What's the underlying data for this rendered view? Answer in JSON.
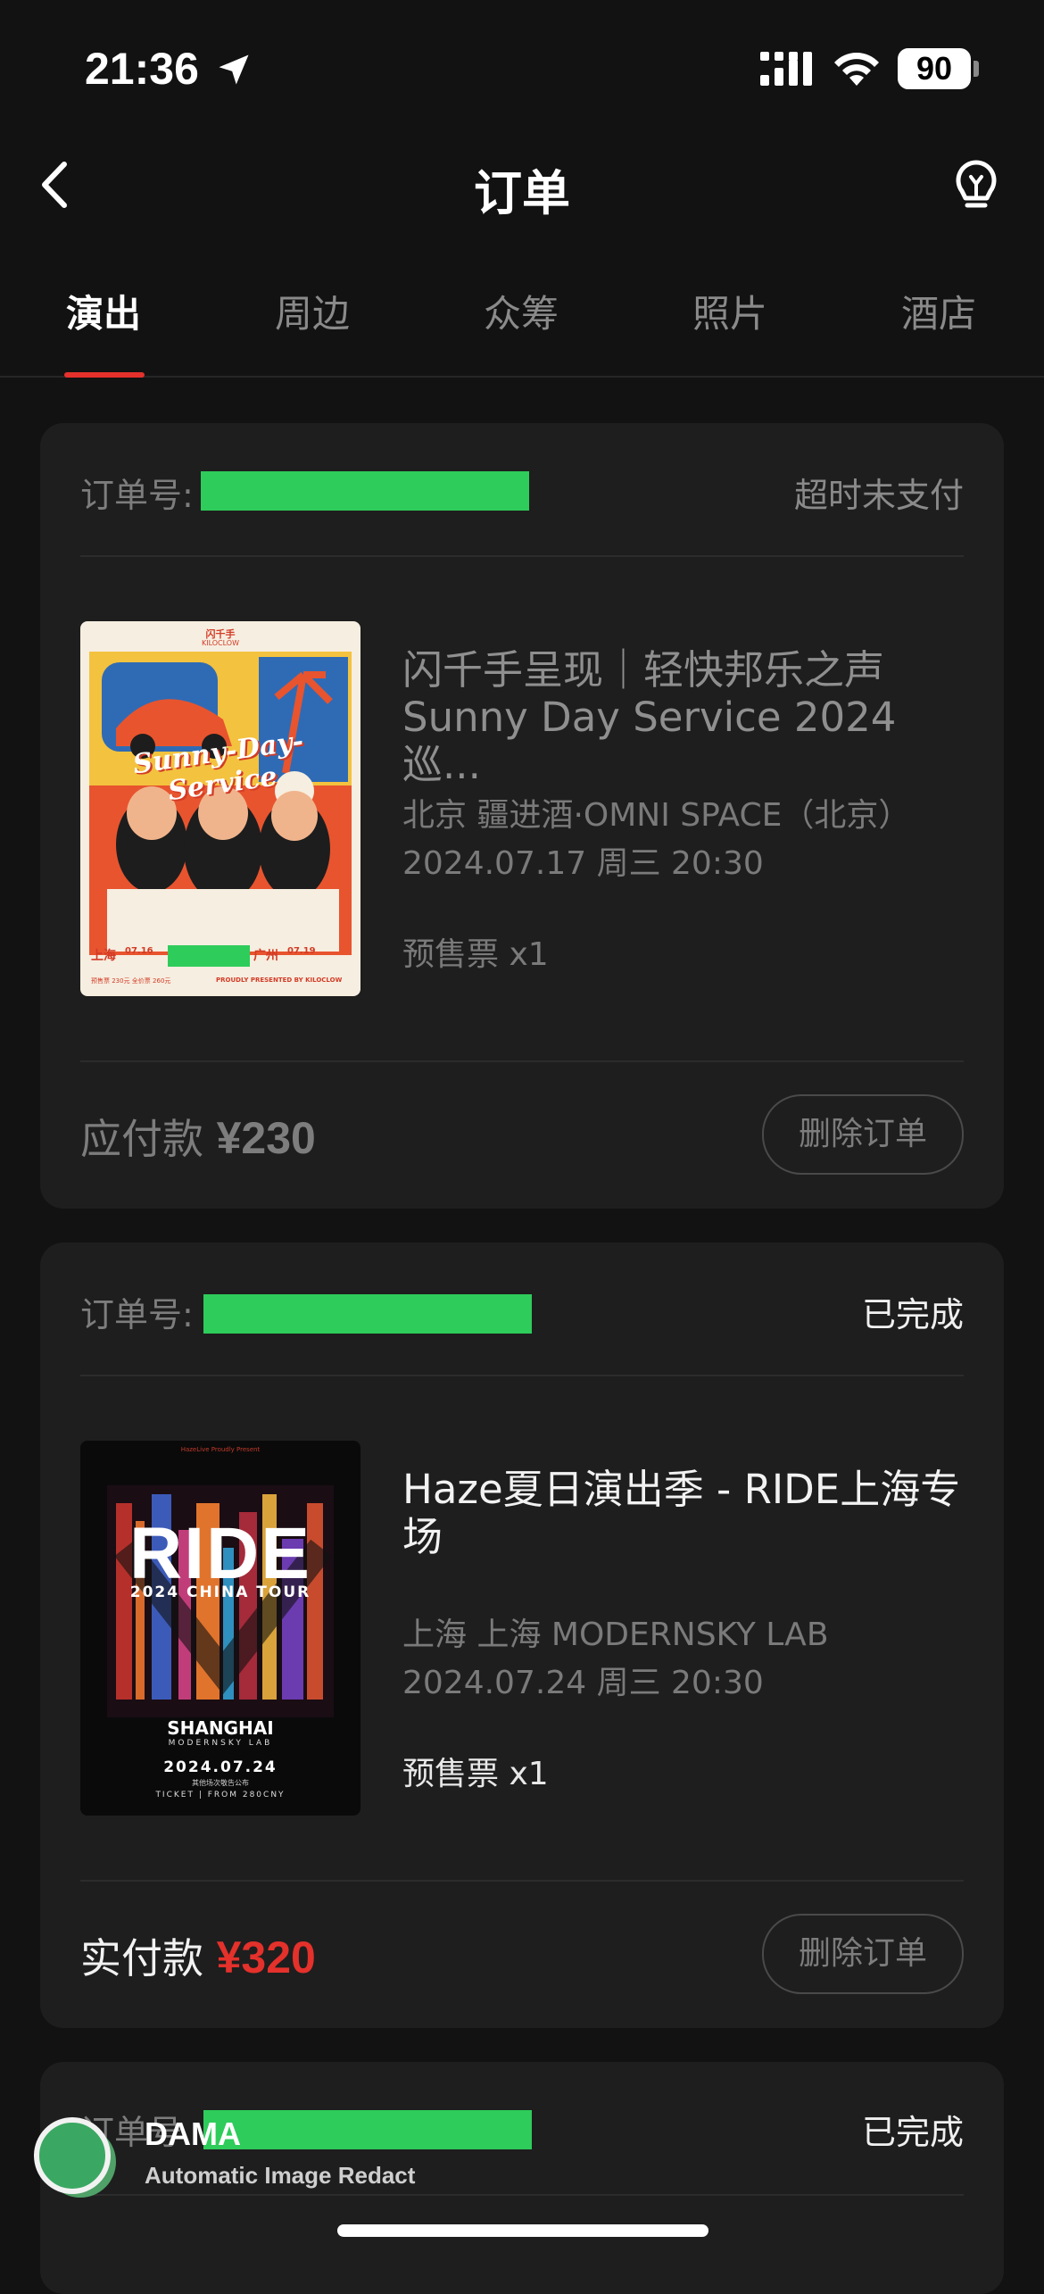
{
  "status_bar": {
    "time": "21:36",
    "battery": "90"
  },
  "nav": {
    "title": "订单"
  },
  "tabs": [
    {
      "label": "演出",
      "active": true
    },
    {
      "label": "周边"
    },
    {
      "label": "众筹"
    },
    {
      "label": "照片"
    },
    {
      "label": "酒店"
    }
  ],
  "orders": [
    {
      "order_label": "订单号:",
      "status": "超时未支付",
      "poster": {
        "top_text": "闪千手",
        "sub_text": "KILOCLOW",
        "script": "Sunny-Day-Service",
        "city1": "上海",
        "date1": "07.16",
        "city2": "广州",
        "date2": "07.19",
        "price_line": "预售票 230元  全价票 260元",
        "credit": "PROUDLY PRESENTED BY KILOCLOW"
      },
      "title": "闪千手呈现｜轻快邦乐之声 Sunny Day Service 2024 巡...",
      "venue": "北京 疆进酒·OMNI SPACE（北京）",
      "date": "2024.07.17 周三 20:30",
      "ticket": "预售票 x1",
      "pay_label": "应付款",
      "amount": "¥230",
      "delete_label": "删除订单"
    },
    {
      "order_label": "订单号:",
      "status": "已完成",
      "poster": {
        "header": "HazeLive Proudly Present",
        "title": "RIDE",
        "tour": "2024 CHINA TOUR",
        "city": "SHANGHAI",
        "venue": "MODERNSKY LAB",
        "date": "2024.07.24",
        "note": "其他场次敬告公布",
        "ticket": "TICKET | FROM 280CNY"
      },
      "title": "Haze夏日演出季 - RIDE上海专场",
      "venue": "上海 上海 MODERNSKY LAB",
      "date": "2024.07.24 周三 20:30",
      "ticket": "预售票 x1",
      "pay_label": "实付款",
      "amount": "¥320",
      "delete_label": "删除订单"
    },
    {
      "order_label": "订单号",
      "status": "已完成"
    }
  ],
  "watermark": {
    "title": "DAMA",
    "subtitle": "Automatic Image Redact"
  },
  "colors": {
    "accent": "#e4312b",
    "redaction": "#2ecc5a",
    "card": "#1e1e1e",
    "background": "#121212"
  }
}
